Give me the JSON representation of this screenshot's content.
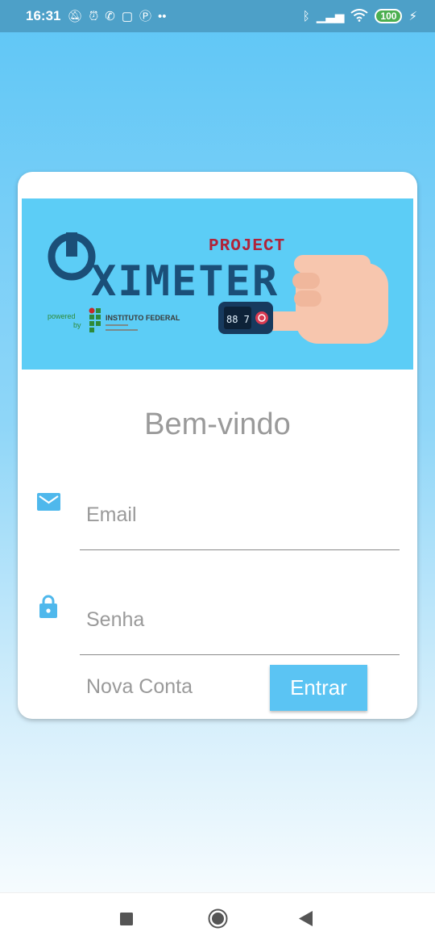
{
  "status_bar": {
    "time": "16:31",
    "left_icons": [
      "mute-icon",
      "alarm-icon",
      "whatsapp-icon",
      "instagram-icon",
      "p-icon",
      "more-dots-icon"
    ],
    "right_icons": [
      "bluetooth-icon",
      "signal-icon",
      "wifi-icon",
      "battery-icon"
    ],
    "battery": "100"
  },
  "banner": {
    "project_text": "PROJECT",
    "logo_text": "XIMETER",
    "powered_by_line1": "powered",
    "powered_by_line2": "by",
    "institute": "INSTITUTO FEDERAL",
    "device_reading": "88 7"
  },
  "login": {
    "welcome": "Bem-vindo",
    "email_placeholder": "Email",
    "password_placeholder": "Senha",
    "new_account": "Nova Conta",
    "submit": "Entrar"
  },
  "colors": {
    "accent": "#5bc4f3",
    "status_bar": "#4da0c8",
    "logo_dark": "#1b4f78",
    "logo_red": "#b0243a"
  },
  "nav_bar": {
    "buttons": [
      "recents-square-icon",
      "home-circle-icon",
      "back-triangle-icon"
    ]
  }
}
